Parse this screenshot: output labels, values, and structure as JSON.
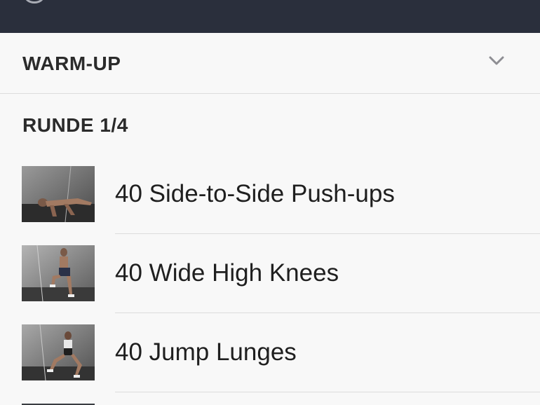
{
  "section": {
    "title": "WARM-UP",
    "expand_icon": "chevron-down-icon"
  },
  "round": {
    "title": "RUNDE 1/4"
  },
  "exercises": [
    {
      "label": "40 Side-to-Side Push-ups",
      "thumb": "push-up-image"
    },
    {
      "label": "40 Wide High Knees",
      "thumb": "high-knees-image"
    },
    {
      "label": "40 Jump Lunges",
      "thumb": "jump-lunges-image"
    }
  ]
}
